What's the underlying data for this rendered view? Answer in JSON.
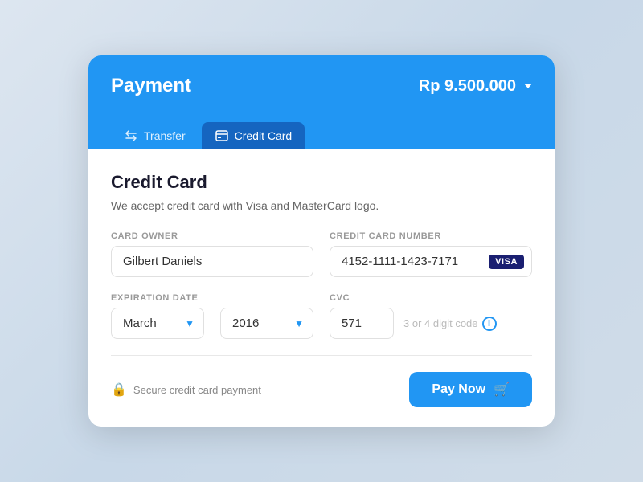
{
  "header": {
    "title": "Payment",
    "amount": "Rp 9.500.000",
    "amount_dropdown": "▾"
  },
  "tabs": [
    {
      "id": "transfer",
      "label": "Transfer",
      "icon": "transfer"
    },
    {
      "id": "credit-card",
      "label": "Credit Card",
      "icon": "credit-card",
      "active": true
    }
  ],
  "body": {
    "section_title": "Credit Card",
    "section_desc": "We accept credit card with Visa and MasterCard logo.",
    "card_owner_label": "CARD OWNER",
    "card_owner_value": "Gilbert Daniels",
    "card_number_label": "CREDIT CARD NUMBER",
    "card_number_value": "4152-1111-1423-7171",
    "visa_badge": "VISA",
    "expiry_label": "EXPIRATION DATE",
    "expiry_month": "March",
    "expiry_year": "2016",
    "cvc_label": "CVC",
    "cvc_value": "571",
    "cvc_hint": "3 or 4 digit code"
  },
  "footer": {
    "secure_label": "Secure credit card payment",
    "pay_button": "Pay Now"
  }
}
